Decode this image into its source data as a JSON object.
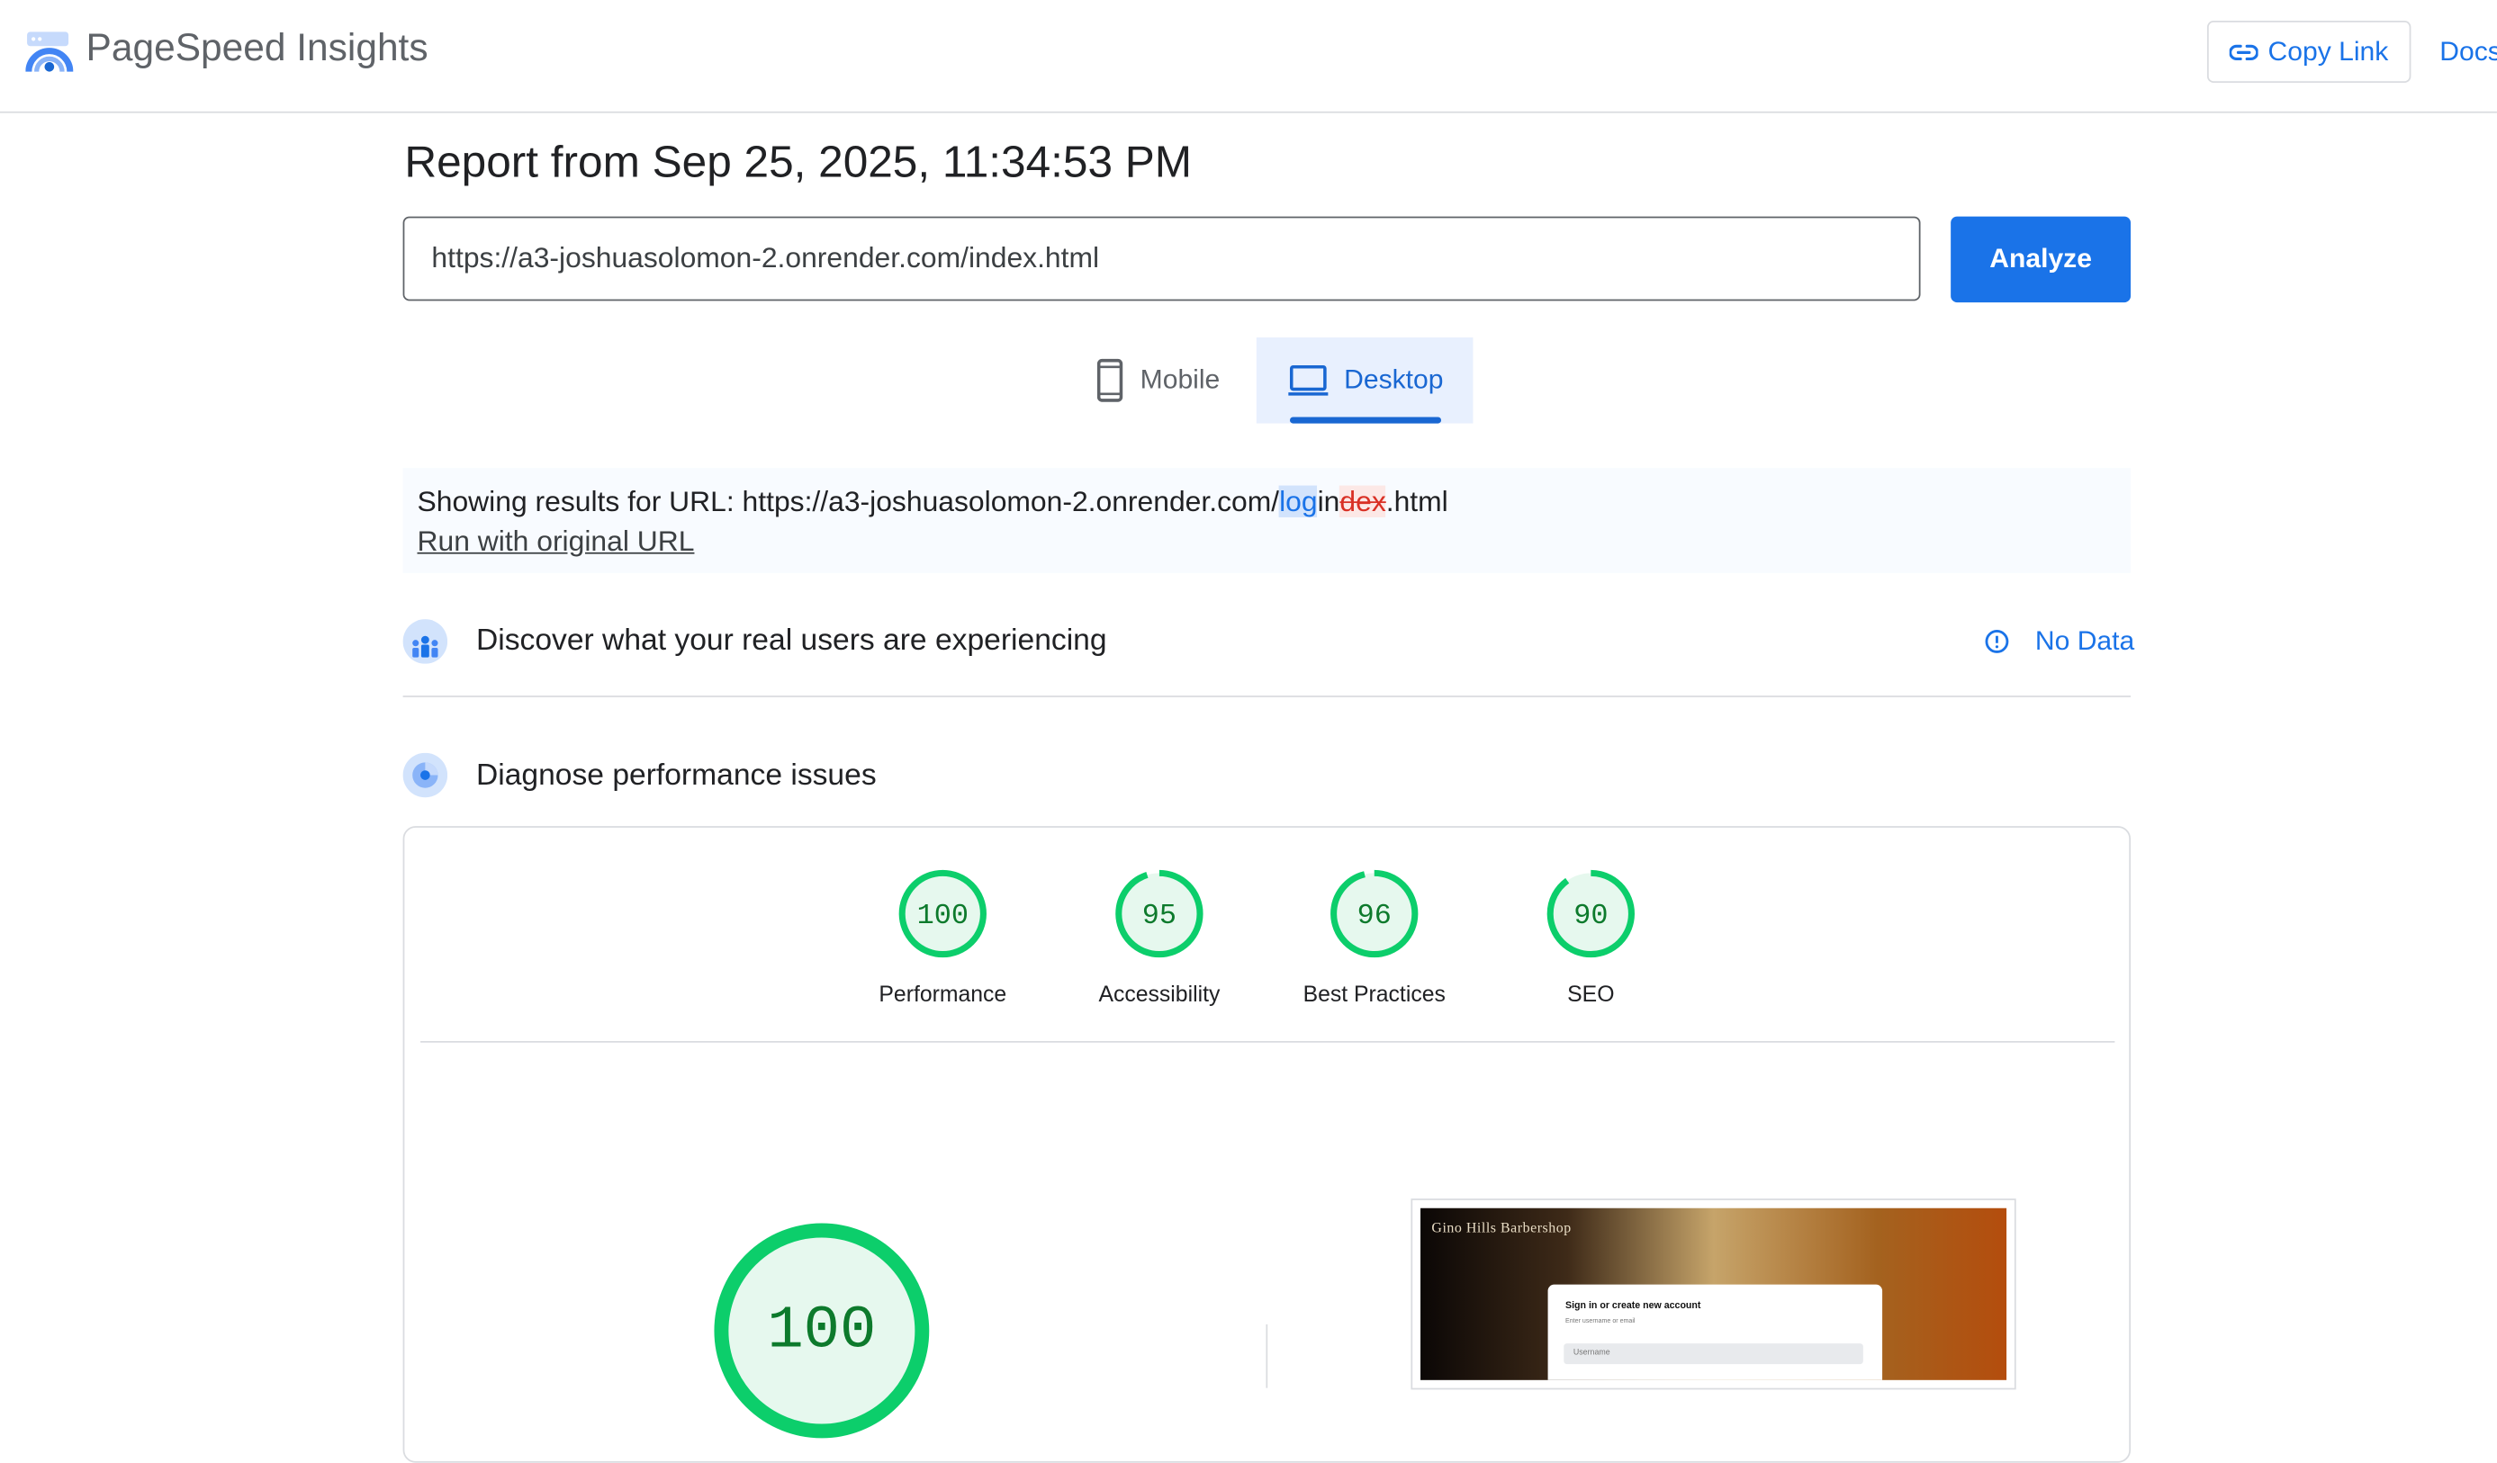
{
  "header": {
    "brand": "PageSpeed Insights",
    "copy_link_label": "Copy Link",
    "docs_label": "Docs",
    "accent_color": "#1a73e8"
  },
  "report": {
    "title": "Report from Sep 25, 2025, 11:34:53 PM",
    "url_value": "https://a3-joshuasolomon-2.onrender.com/index.html",
    "analyze_label": "Analyze"
  },
  "device_tabs": [
    {
      "label": "Mobile",
      "icon": "smartphone-icon",
      "selected": false
    },
    {
      "label": "Desktop",
      "icon": "laptop-icon",
      "selected": true
    }
  ],
  "results": {
    "prefix": "Showing results for URL: https://a3-joshuasolomon-2.onrender.com/",
    "added": "log",
    "kept": "in",
    "removed": "dex",
    "suffix": ".html",
    "run_original_label": "Run with original URL"
  },
  "field_data": {
    "title": "Discover what your real users are experiencing",
    "status": "No Data",
    "icon": "users-icon",
    "status_icon": "info-icon"
  },
  "diagnose": {
    "title": "Diagnose performance issues",
    "icon": "lab-icon"
  },
  "scores": [
    {
      "label": "Performance",
      "value": "100",
      "fraction": 1.0
    },
    {
      "label": "Accessibility",
      "value": "95",
      "fraction": 0.95
    },
    {
      "label": "Best Practices",
      "value": "96",
      "fraction": 0.96
    },
    {
      "label": "SEO",
      "value": "90",
      "fraction": 0.9
    }
  ],
  "main_score": {
    "value": "100",
    "fraction": 1.0
  },
  "score_colors": {
    "good": "#0cce6b",
    "good_fill": "#e6f8ee",
    "good_text": "#0d7a2c"
  },
  "screenshot": {
    "site_title": "Gino Hills Barbershop",
    "card_title": "Sign in or create new account",
    "card_subtitle": "Enter username or email",
    "field_placeholder": "Username"
  }
}
